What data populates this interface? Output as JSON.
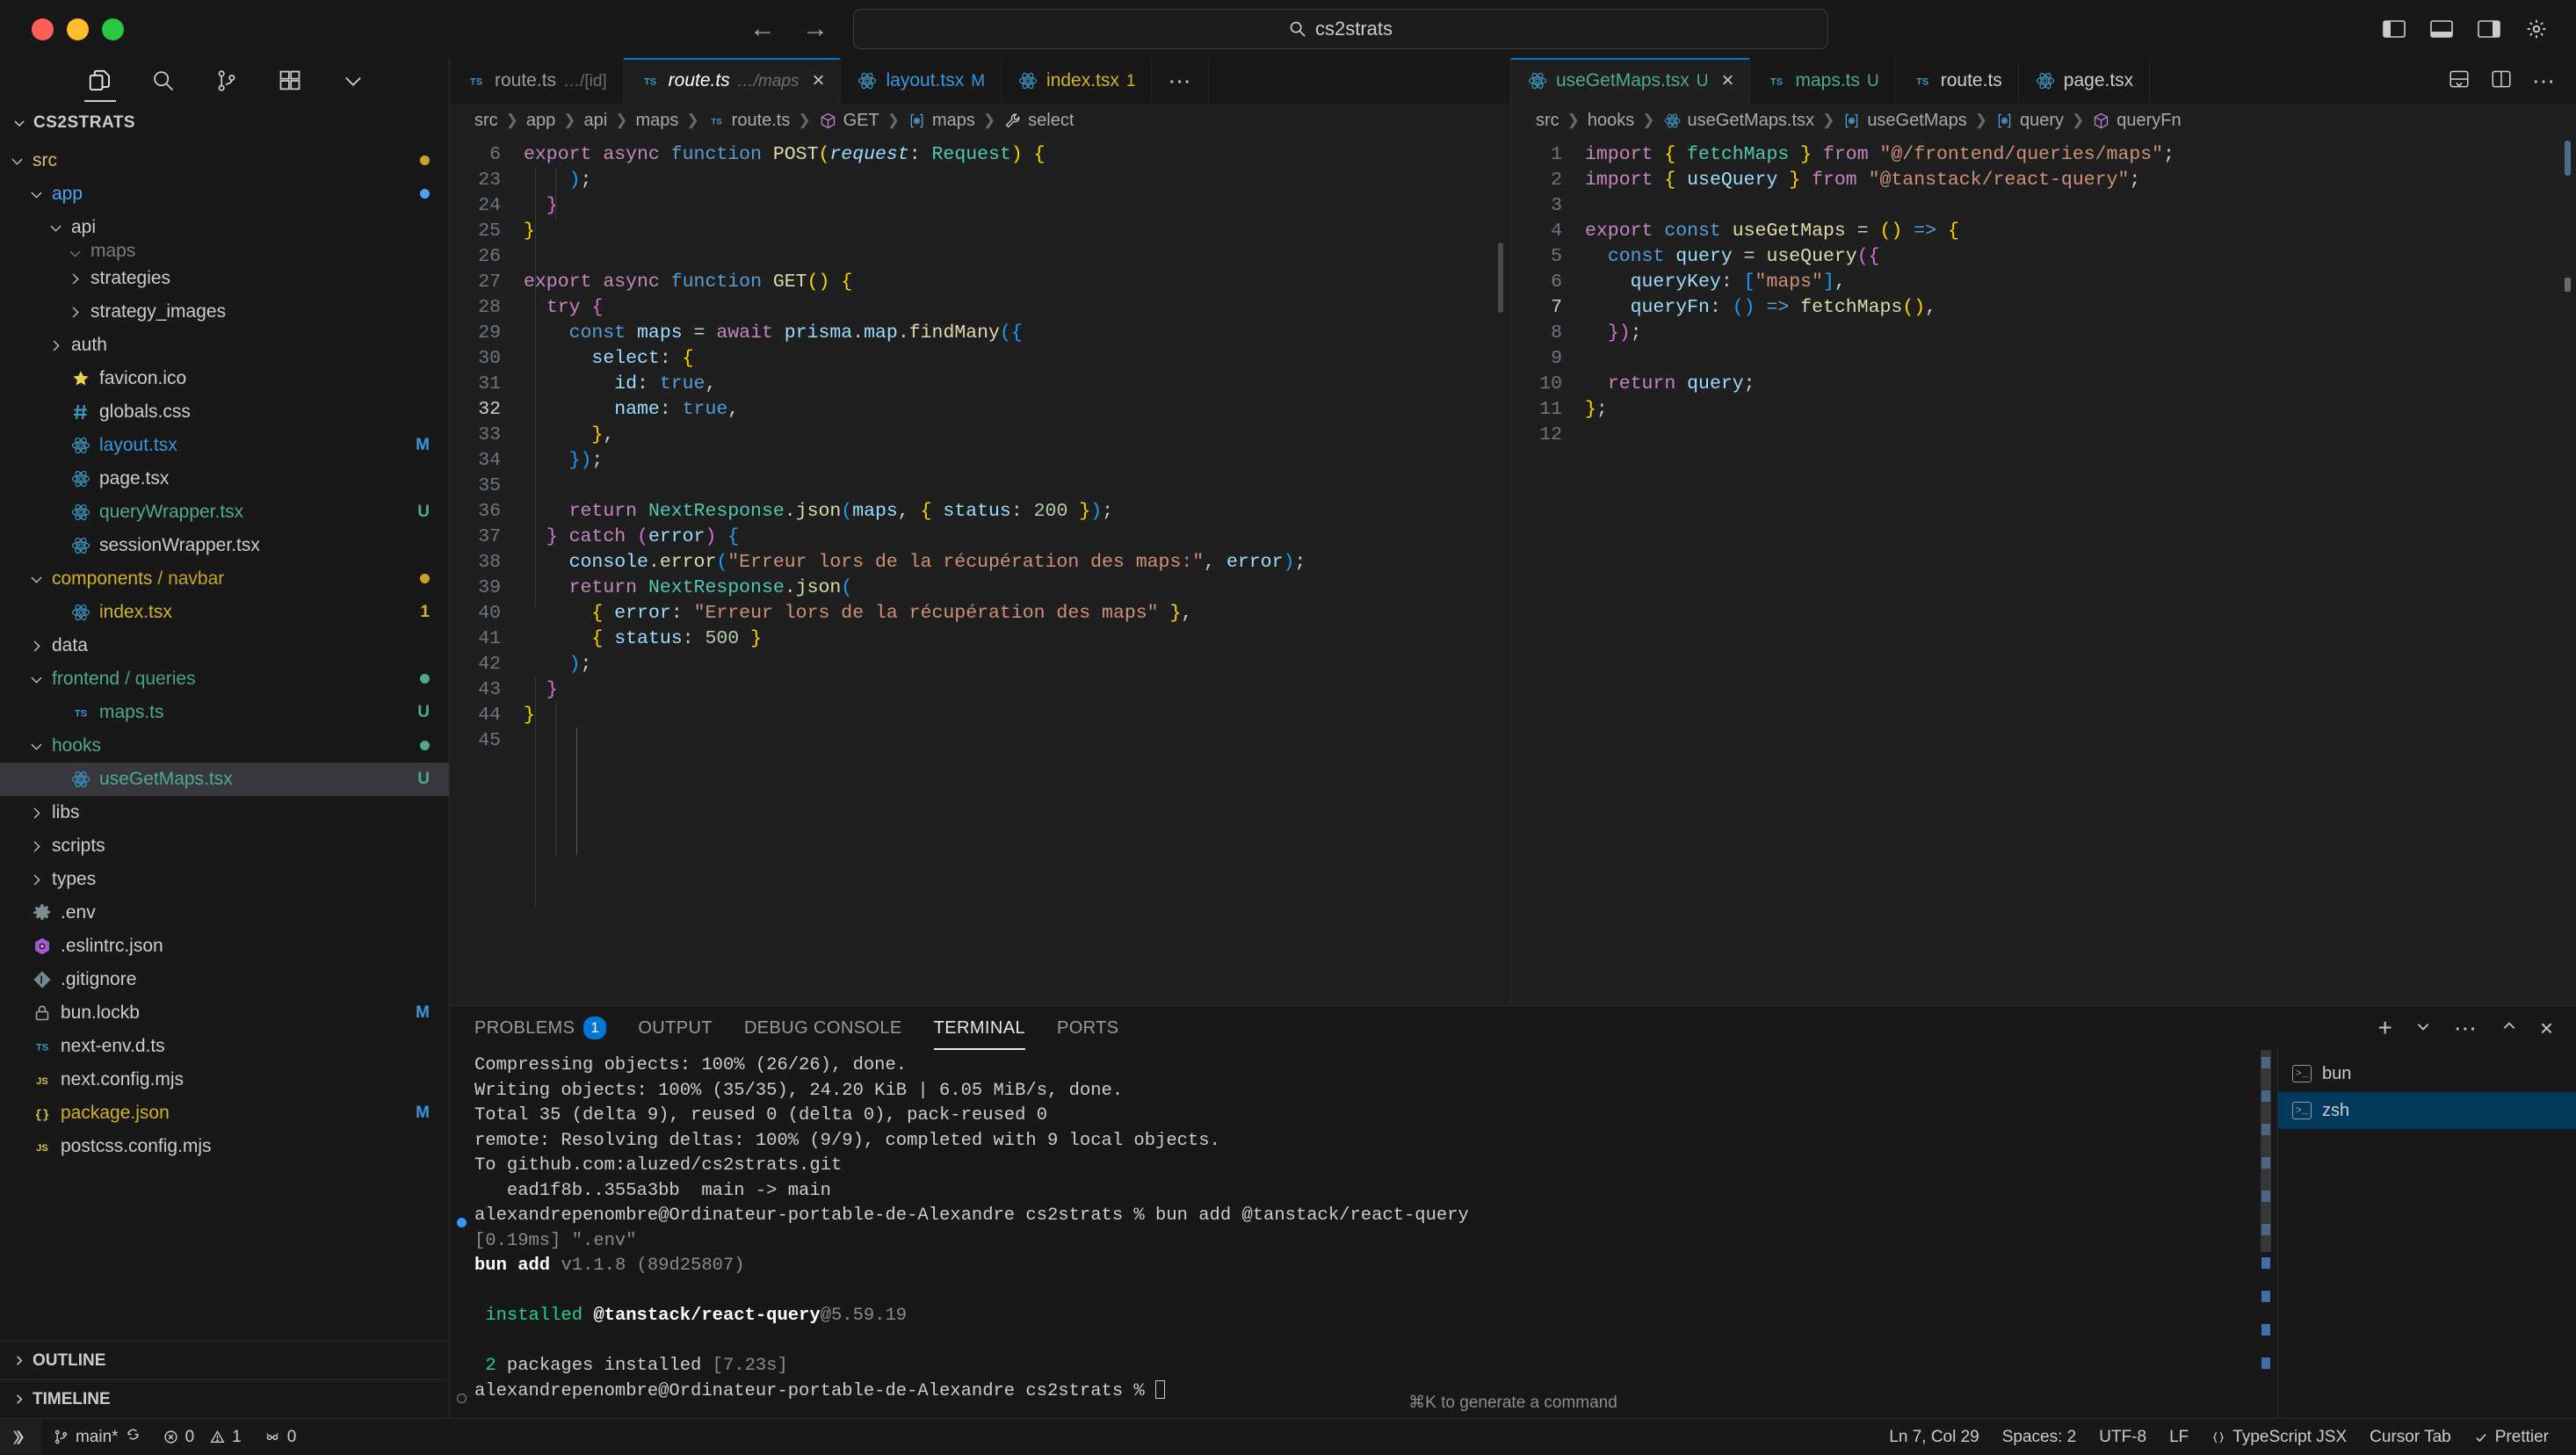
{
  "titlebar": {
    "search_text": "cs2strats",
    "back_arrow": "←",
    "forward_arrow": "→"
  },
  "sidebar": {
    "title": "CS2STRATS",
    "tree": [
      {
        "label": "src",
        "indent": 1,
        "type": "folder",
        "state": "open",
        "color": "#dcb67a",
        "badge": "",
        "badge_color": "",
        "dot": "#c9a227"
      },
      {
        "label": "app",
        "indent": 2,
        "type": "folder",
        "state": "open",
        "color": "#4ea1f3",
        "badge": "",
        "badge_color": "",
        "dot": "#4ea1f3"
      },
      {
        "label": "api",
        "indent": 3,
        "type": "folder",
        "state": "open",
        "color": "#cccccc",
        "badge": "",
        "badge_color": "",
        "dot": ""
      },
      {
        "label": "maps",
        "indent": 4,
        "type": "folder",
        "state": "open",
        "color": "#cccccc",
        "badge": "",
        "badge_color": "",
        "dot": "",
        "clipped": true
      },
      {
        "label": "strategies",
        "indent": 4,
        "type": "folder",
        "state": "closed",
        "color": "#cccccc",
        "badge": "",
        "badge_color": "",
        "dot": ""
      },
      {
        "label": "strategy_images",
        "indent": 4,
        "type": "folder",
        "state": "closed",
        "color": "#cccccc",
        "badge": "",
        "badge_color": "",
        "dot": ""
      },
      {
        "label": "auth",
        "indent": 3,
        "type": "folder",
        "state": "closed",
        "color": "#cccccc",
        "badge": "",
        "badge_color": "",
        "dot": ""
      },
      {
        "label": "favicon.ico",
        "indent": 3,
        "type": "file",
        "icon": "star",
        "color": "#cccccc",
        "badge": "",
        "badge_color": "",
        "dot": ""
      },
      {
        "label": "globals.css",
        "indent": 3,
        "type": "file",
        "icon": "hash",
        "color": "#cccccc",
        "badge": "",
        "badge_color": "",
        "dot": ""
      },
      {
        "label": "layout.tsx",
        "indent": 3,
        "type": "file",
        "icon": "react",
        "color": "#3a97df",
        "badge": "M",
        "badge_color": "#3a97df",
        "dot": ""
      },
      {
        "label": "page.tsx",
        "indent": 3,
        "type": "file",
        "icon": "react",
        "color": "#cccccc",
        "badge": "",
        "badge_color": "",
        "dot": ""
      },
      {
        "label": "queryWrapper.tsx",
        "indent": 3,
        "type": "file",
        "icon": "react",
        "color": "#4faa8c",
        "badge": "U",
        "badge_color": "#4faa8c",
        "dot": ""
      },
      {
        "label": "sessionWrapper.tsx",
        "indent": 3,
        "type": "file",
        "icon": "react",
        "color": "#cccccc",
        "badge": "",
        "badge_color": "",
        "dot": ""
      },
      {
        "label": "components",
        "sublabel": "navbar",
        "indent": 2,
        "type": "folder",
        "state": "open",
        "color": "#d1b22e",
        "badge": "",
        "badge_color": "",
        "dot": "#c9a227"
      },
      {
        "label": "index.tsx",
        "indent": 3,
        "type": "file",
        "icon": "react",
        "color": "#d1b22e",
        "badge": "1",
        "badge_color": "#d1b22e",
        "dot": ""
      },
      {
        "label": "data",
        "indent": 2,
        "type": "folder",
        "state": "closed",
        "color": "#cccccc",
        "badge": "",
        "badge_color": "",
        "dot": ""
      },
      {
        "label": "frontend",
        "sublabel": "queries",
        "indent": 2,
        "type": "folder",
        "state": "open",
        "color": "#4faa8c",
        "badge": "",
        "badge_color": "",
        "dot": "#4faa8c"
      },
      {
        "label": "maps.ts",
        "indent": 3,
        "type": "file",
        "icon": "ts",
        "color": "#4faa8c",
        "badge": "U",
        "badge_color": "#4faa8c",
        "dot": ""
      },
      {
        "label": "hooks",
        "indent": 2,
        "type": "folder",
        "state": "open",
        "color": "#4faa8c",
        "badge": "",
        "badge_color": "",
        "dot": "#4faa8c"
      },
      {
        "label": "useGetMaps.tsx",
        "indent": 3,
        "type": "file",
        "icon": "react",
        "color": "#4faa8c",
        "badge": "U",
        "badge_color": "#4faa8c",
        "dot": "",
        "selected": true
      },
      {
        "label": "libs",
        "indent": 2,
        "type": "folder",
        "state": "closed",
        "color": "#cccccc",
        "badge": "",
        "badge_color": "",
        "dot": ""
      },
      {
        "label": "scripts",
        "indent": 2,
        "type": "folder",
        "state": "closed",
        "color": "#cccccc",
        "badge": "",
        "badge_color": "",
        "dot": ""
      },
      {
        "label": "types",
        "indent": 2,
        "type": "folder",
        "state": "closed",
        "color": "#cccccc",
        "badge": "",
        "badge_color": "",
        "dot": ""
      },
      {
        "label": ".env",
        "indent": 1,
        "type": "file",
        "icon": "gear",
        "color": "#cccccc",
        "badge": "",
        "badge_color": "",
        "dot": ""
      },
      {
        "label": ".eslintrc.json",
        "indent": 1,
        "type": "file",
        "icon": "eslint",
        "color": "#cccccc",
        "badge": "",
        "badge_color": "",
        "dot": ""
      },
      {
        "label": ".gitignore",
        "indent": 1,
        "type": "file",
        "icon": "git",
        "color": "#cccccc",
        "badge": "",
        "badge_color": "",
        "dot": ""
      },
      {
        "label": "bun.lockb",
        "indent": 1,
        "type": "file",
        "icon": "lock",
        "color": "#cccccc",
        "badge": "M",
        "badge_color": "#3a97df",
        "dot": ""
      },
      {
        "label": "next-env.d.ts",
        "indent": 1,
        "type": "file",
        "icon": "ts",
        "color": "#cccccc",
        "badge": "",
        "badge_color": "",
        "dot": ""
      },
      {
        "label": "next.config.mjs",
        "indent": 1,
        "type": "file",
        "icon": "js",
        "color": "#cccccc",
        "badge": "",
        "badge_color": "",
        "dot": ""
      },
      {
        "label": "package.json",
        "indent": 1,
        "type": "file",
        "icon": "json",
        "color": "#d1b22e",
        "badge": "M",
        "badge_color": "#3a97df",
        "dot": ""
      },
      {
        "label": "postcss.config.mjs",
        "indent": 1,
        "type": "file",
        "icon": "js",
        "color": "#cccccc",
        "badge": "",
        "badge_color": "",
        "dot": ""
      }
    ],
    "footer": [
      {
        "label": "OUTLINE"
      },
      {
        "label": "TIMELINE"
      }
    ]
  },
  "left_group": {
    "tabs": [
      {
        "name": "route.ts",
        "sub": "…/[id]",
        "icon": "ts",
        "badge": "",
        "badge_color": "",
        "active": false,
        "italic": false,
        "close": false
      },
      {
        "name": "route.ts",
        "sub": "…/maps",
        "icon": "ts",
        "badge": "",
        "badge_color": "",
        "active": true,
        "italic": true,
        "close": true
      },
      {
        "name": "layout.tsx",
        "sub": "",
        "icon": "react",
        "badge": "M",
        "badge_color": "#3a97df",
        "active": false,
        "italic": false,
        "close": false,
        "name_color": "#3a97df"
      },
      {
        "name": "index.tsx",
        "sub": "",
        "icon": "react",
        "badge": "1",
        "badge_color": "#d1b22e",
        "active": false,
        "italic": false,
        "close": false,
        "name_color": "#d1b22e"
      }
    ],
    "overflow": "⋯",
    "breadcrumb": [
      {
        "text": "src",
        "icon": ""
      },
      {
        "text": "app",
        "icon": ""
      },
      {
        "text": "api",
        "icon": ""
      },
      {
        "text": "maps",
        "icon": ""
      },
      {
        "text": "route.ts",
        "icon": "ts"
      },
      {
        "text": "GET",
        "icon": "cube"
      },
      {
        "text": "maps",
        "icon": "field"
      },
      {
        "text": "select",
        "icon": "wrench"
      }
    ],
    "lines": [
      {
        "n": "6",
        "html": "<span class=\"kc\">export</span> <span class=\"kc\">async</span> <span class=\"k\">function</span> <span class=\"fn\">POST</span><span class=\"p1\">(</span><span class=\"va it\">request</span><span class=\"pl\">: </span><span class=\"ty\">Request</span><span class=\"p1\">)</span> <span class=\"p1\">{</span>"
      },
      {
        "n": "23",
        "html": "    <span class=\"p3\">)</span><span class=\"pl\">;</span>"
      },
      {
        "n": "24",
        "html": "  <span class=\"p2\">}</span>"
      },
      {
        "n": "25",
        "html": "<span class=\"p1\">}</span>"
      },
      {
        "n": "26",
        "html": ""
      },
      {
        "n": "27",
        "html": "<span class=\"kc\">export</span> <span class=\"kc\">async</span> <span class=\"k\">function</span> <span class=\"fn\">GET</span><span class=\"p1\">()</span> <span class=\"p1\">{</span>"
      },
      {
        "n": "28",
        "html": "  <span class=\"kc\">try</span> <span class=\"p2\">{</span>"
      },
      {
        "n": "29",
        "html": "    <span class=\"k\">const</span> <span class=\"va\">maps</span> <span class=\"pl\">=</span> <span class=\"kc\">await</span> <span class=\"va\">prisma</span><span class=\"pl\">.</span><span class=\"va\">map</span><span class=\"pl\">.</span><span class=\"fn\">findMany</span><span class=\"p3\">({</span>"
      },
      {
        "n": "30",
        "html": "      <span class=\"va\">select</span><span class=\"pl\">: </span><span class=\"p1\">{</span>"
      },
      {
        "n": "31",
        "html": "        <span class=\"va\">id</span><span class=\"pl\">: </span><span class=\"k\">true</span><span class=\"pl\">,</span>"
      },
      {
        "n": "32",
        "html": "        <span class=\"va\">name</span><span class=\"pl\">: </span><span class=\"k\">true</span><span class=\"pl\">,</span>",
        "current": true
      },
      {
        "n": "33",
        "html": "      <span class=\"p1\">}</span><span class=\"pl\">,</span>"
      },
      {
        "n": "34",
        "html": "    <span class=\"p3\">})</span><span class=\"pl\">;</span>"
      },
      {
        "n": "35",
        "html": ""
      },
      {
        "n": "36",
        "html": "    <span class=\"kc\">return</span> <span class=\"ty\">NextResponse</span><span class=\"pl\">.</span><span class=\"fn\">json</span><span class=\"p3\">(</span><span class=\"va\">maps</span><span class=\"pl\">, </span><span class=\"p1\">{</span> <span class=\"va\">status</span><span class=\"pl\">: </span><span class=\"nu\">200</span> <span class=\"p1\">}</span><span class=\"p3\">)</span><span class=\"pl\">;</span>"
      },
      {
        "n": "37",
        "html": "  <span class=\"p2\">}</span> <span class=\"kc\">catch</span> <span class=\"p2\">(</span><span class=\"va\">error</span><span class=\"p2\">)</span> <span class=\"p3\">{</span>"
      },
      {
        "n": "38",
        "html": "    <span class=\"va\">console</span><span class=\"pl\">.</span><span class=\"fn\">error</span><span class=\"p3\">(</span><span class=\"st\">\"Erreur lors de la récupération des maps:\"</span><span class=\"pl\">, </span><span class=\"va\">error</span><span class=\"p3\">)</span><span class=\"pl\">;</span>"
      },
      {
        "n": "39",
        "html": "    <span class=\"kc\">return</span> <span class=\"ty\">NextResponse</span><span class=\"pl\">.</span><span class=\"fn\">json</span><span class=\"p3\">(</span>"
      },
      {
        "n": "40",
        "html": "      <span class=\"p1\">{</span> <span class=\"va\">error</span><span class=\"pl\">: </span><span class=\"st\">\"Erreur lors de la récupération des maps\"</span> <span class=\"p1\">}</span><span class=\"pl\">,</span>"
      },
      {
        "n": "41",
        "html": "      <span class=\"p1\">{</span> <span class=\"va\">status</span><span class=\"pl\">: </span><span class=\"nu\">500</span> <span class=\"p1\">}</span>"
      },
      {
        "n": "42",
        "html": "    <span class=\"p3\">)</span><span class=\"pl\">;</span>"
      },
      {
        "n": "43",
        "html": "  <span class=\"p2\">}</span>"
      },
      {
        "n": "44",
        "html": "<span class=\"p1\">}</span>"
      },
      {
        "n": "45",
        "html": ""
      }
    ]
  },
  "right_group": {
    "tabs": [
      {
        "name": "useGetMaps.tsx",
        "icon": "react",
        "badge": "U",
        "badge_color": "#4faa8c",
        "active": true,
        "close": true,
        "name_color": "#4faa8c"
      },
      {
        "name": "maps.ts",
        "icon": "ts",
        "badge": "U",
        "badge_color": "#4faa8c",
        "active": false,
        "close": false,
        "name_color": "#4faa8c"
      },
      {
        "name": "route.ts",
        "icon": "ts",
        "badge": "",
        "badge_color": "",
        "active": false,
        "close": false,
        "name_color": "#cccccc"
      },
      {
        "name": "page.tsx",
        "icon": "react",
        "badge": "",
        "badge_color": "",
        "active": false,
        "close": false,
        "name_color": "#cccccc"
      }
    ],
    "breadcrumb": [
      {
        "text": "src",
        "icon": ""
      },
      {
        "text": "hooks",
        "icon": ""
      },
      {
        "text": "useGetMaps.tsx",
        "icon": "react"
      },
      {
        "text": "useGetMaps",
        "icon": "field"
      },
      {
        "text": "query",
        "icon": "field"
      },
      {
        "text": "queryFn",
        "icon": "cube"
      }
    ],
    "lines": [
      {
        "n": "1",
        "html": "<span class=\"kc\">import</span> <span class=\"p1\">{</span> <span class=\"ty\">fetchMaps</span> <span class=\"p1\">}</span> <span class=\"kc\">from</span> <span class=\"st\">\"@/frontend/queries/maps\"</span><span class=\"pl\">;</span>"
      },
      {
        "n": "2",
        "html": "<span class=\"kc\">import</span> <span class=\"p1\">{</span> <span class=\"va\">useQuery</span> <span class=\"p1\">}</span> <span class=\"kc\">from</span> <span class=\"st\">\"@tanstack/react-query\"</span><span class=\"pl\">;</span>"
      },
      {
        "n": "3",
        "html": ""
      },
      {
        "n": "4",
        "html": "<span class=\"kc\">export</span> <span class=\"k\">const</span> <span class=\"fn\">useGetMaps</span> <span class=\"pl\">= </span><span class=\"p1\">()</span> <span class=\"k\">=&gt;</span> <span class=\"p1\">{</span>"
      },
      {
        "n": "5",
        "html": "  <span class=\"k\">const</span> <span class=\"va\">query</span> <span class=\"pl\">= </span><span class=\"fn\">useQuery</span><span class=\"p2\">({</span>"
      },
      {
        "n": "6",
        "html": "    <span class=\"va\">queryKey</span><span class=\"pl\">: </span><span class=\"p3\">[</span><span class=\"st\">\"maps\"</span><span class=\"p3\">]</span><span class=\"pl\">,</span>"
      },
      {
        "n": "7",
        "html": "    <span class=\"va\">queryFn</span><span class=\"pl\">: </span><span class=\"p3\">()</span> <span class=\"k\">=&gt;</span> <span class=\"fn\">fetchMaps</span><span class=\"p1\">()</span><span class=\"pl\">,</span>",
        "current": true
      },
      {
        "n": "8",
        "html": "  <span class=\"p2\">})</span><span class=\"pl\">;</span>"
      },
      {
        "n": "9",
        "html": ""
      },
      {
        "n": "10",
        "html": "  <span class=\"kc\">return</span> <span class=\"va\">query</span><span class=\"pl\">;</span>"
      },
      {
        "n": "11",
        "html": "<span class=\"p1\">}</span><span class=\"pl\">;</span>"
      },
      {
        "n": "12",
        "html": ""
      }
    ]
  },
  "panel": {
    "tabs": [
      {
        "label": "PROBLEMS",
        "count": "1",
        "active": false
      },
      {
        "label": "OUTPUT",
        "count": "",
        "active": false
      },
      {
        "label": "DEBUG CONSOLE",
        "count": "",
        "active": false
      },
      {
        "label": "TERMINAL",
        "count": "",
        "active": true
      },
      {
        "label": "PORTS",
        "count": "",
        "active": false
      }
    ],
    "terminal_lines": [
      {
        "html": "Compressing objects: 100% (26/26), done."
      },
      {
        "html": "Writing objects: 100% (35/35), 24.20 KiB | 6.05 MiB/s, done."
      },
      {
        "html": "Total 35 (delta 9), reused 0 (delta 0), pack-reused 0"
      },
      {
        "html": "remote: Resolving deltas: 100% (9/9), completed with 9 local objects."
      },
      {
        "html": "To github.com:aluzed/cs2strats.git"
      },
      {
        "html": "   ead1f8b..355a3bb  main -&gt; main"
      },
      {
        "html": "alexandrepenombre@Ordinateur-portable-de-Alexandre cs2strats % bun add @tanstack/react-query",
        "mark": "blue"
      },
      {
        "html": "<span class=\"g-dim\">[0.19ms] \".env\"</span>"
      },
      {
        "html": "<span class=\"g-bold\">bun add</span> <span class=\"g-dim\">v1.1.8 (89d25807)</span>"
      },
      {
        "html": ""
      },
      {
        "html": " <span class=\"g-green\">installed</span> <span class=\"g-bold\">@tanstack/react-query</span><span class=\"g-dim\">@5.59.19</span>"
      },
      {
        "html": ""
      },
      {
        "html": " <span class=\"g-green\">2</span> packages installed <span class=\"g-dim\">[7.23s]</span>"
      },
      {
        "html": "alexandrepenombre@Ordinateur-portable-de-Alexandre cs2strats % <span class=\"cursorblk\"></span>",
        "mark": "hollow"
      }
    ],
    "hint": "⌘K to generate a command",
    "terminals": [
      {
        "label": "bun",
        "selected": false
      },
      {
        "label": "zsh",
        "selected": true
      }
    ]
  },
  "statusbar": {
    "remote_label": "",
    "branch": "main*",
    "sync": "↻",
    "errors": "0",
    "warnings": "1",
    "ports": "0",
    "position": "Ln 7, Col 29",
    "spaces": "Spaces: 2",
    "encoding": "UTF-8",
    "eol": "LF",
    "language": "TypeScript JSX",
    "cursor_tab": "Cursor Tab",
    "prettier": "Prettier"
  }
}
